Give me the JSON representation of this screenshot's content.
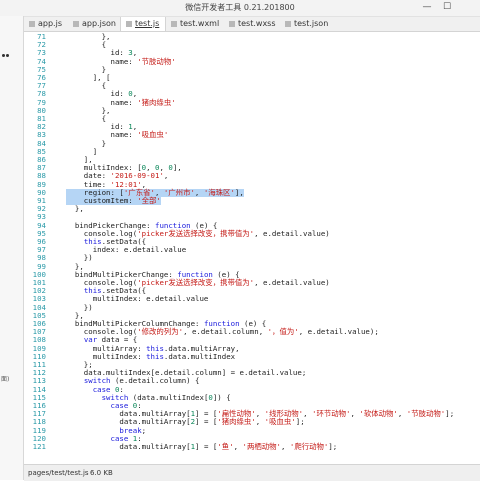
{
  "window": {
    "title": "微信开发者工具 0.21.201800",
    "minimize": "—",
    "maximize": "☐"
  },
  "sidebar": {
    "fragment_text": "面)"
  },
  "tabs": [
    {
      "label": "app.js",
      "active": false
    },
    {
      "label": "app.json",
      "active": false
    },
    {
      "label": "test.js",
      "active": true
    },
    {
      "label": "test.wxml",
      "active": false
    },
    {
      "label": "test.wxss",
      "active": false
    },
    {
      "label": "test.json",
      "active": false
    }
  ],
  "editor": {
    "lines": [
      {
        "num": "71",
        "tokens": [
          {
            "t": "        },",
            "c": "p"
          }
        ]
      },
      {
        "num": "72",
        "tokens": [
          {
            "t": "        {",
            "c": "p"
          }
        ]
      },
      {
        "num": "73",
        "tokens": [
          {
            "t": "          id: ",
            "c": "p"
          },
          {
            "t": "3",
            "c": "n"
          },
          {
            "t": ",",
            "c": "p"
          }
        ]
      },
      {
        "num": "74",
        "tokens": [
          {
            "t": "          name: ",
            "c": "p"
          },
          {
            "t": "'节肢动物'",
            "c": "s"
          }
        ]
      },
      {
        "num": "75",
        "tokens": [
          {
            "t": "        }",
            "c": "p"
          }
        ]
      },
      {
        "num": "76",
        "tokens": [
          {
            "t": "      ], [",
            "c": "p"
          }
        ]
      },
      {
        "num": "77",
        "tokens": [
          {
            "t": "        {",
            "c": "p"
          }
        ]
      },
      {
        "num": "78",
        "tokens": [
          {
            "t": "          id: ",
            "c": "p"
          },
          {
            "t": "0",
            "c": "n"
          },
          {
            "t": ",",
            "c": "p"
          }
        ]
      },
      {
        "num": "79",
        "tokens": [
          {
            "t": "          name: ",
            "c": "p"
          },
          {
            "t": "'猪肉绦虫'",
            "c": "s"
          }
        ]
      },
      {
        "num": "80",
        "tokens": [
          {
            "t": "        },",
            "c": "p"
          }
        ]
      },
      {
        "num": "81",
        "tokens": [
          {
            "t": "        {",
            "c": "p"
          }
        ]
      },
      {
        "num": "82",
        "tokens": [
          {
            "t": "          id: ",
            "c": "p"
          },
          {
            "t": "1",
            "c": "n"
          },
          {
            "t": ",",
            "c": "p"
          }
        ]
      },
      {
        "num": "83",
        "tokens": [
          {
            "t": "          name: ",
            "c": "p"
          },
          {
            "t": "'吸血虫'",
            "c": "s"
          }
        ]
      },
      {
        "num": "84",
        "tokens": [
          {
            "t": "        }",
            "c": "p"
          }
        ]
      },
      {
        "num": "85",
        "tokens": [
          {
            "t": "      ]",
            "c": "p"
          }
        ]
      },
      {
        "num": "86",
        "tokens": [
          {
            "t": "    ],",
            "c": "p"
          }
        ]
      },
      {
        "num": "87",
        "tokens": [
          {
            "t": "    multiIndex: [",
            "c": "p"
          },
          {
            "t": "0",
            "c": "n"
          },
          {
            "t": ", ",
            "c": "p"
          },
          {
            "t": "0",
            "c": "n"
          },
          {
            "t": ", ",
            "c": "p"
          },
          {
            "t": "0",
            "c": "n"
          },
          {
            "t": "],",
            "c": "p"
          }
        ]
      },
      {
        "num": "88",
        "tokens": [
          {
            "t": "    date: ",
            "c": "p"
          },
          {
            "t": "'2016-09-01'",
            "c": "s"
          },
          {
            "t": ",",
            "c": "p"
          }
        ]
      },
      {
        "num": "89",
        "tokens": [
          {
            "t": "    time: ",
            "c": "p"
          },
          {
            "t": "'12:01'",
            "c": "s"
          },
          {
            "t": ",",
            "c": "p"
          }
        ]
      },
      {
        "num": "90",
        "hl": true,
        "tokens": [
          {
            "t": "    region: [",
            "c": "p"
          },
          {
            "t": "'广东省'",
            "c": "s"
          },
          {
            "t": ", ",
            "c": "p"
          },
          {
            "t": "'广州市'",
            "c": "s"
          },
          {
            "t": ", ",
            "c": "p"
          },
          {
            "t": "'海珠区'",
            "c": "s"
          },
          {
            "t": "],",
            "c": "p"
          }
        ]
      },
      {
        "num": "91",
        "hl": true,
        "tokens": [
          {
            "t": "    customItem: ",
            "c": "p"
          },
          {
            "t": "'全部'",
            "c": "s"
          }
        ]
      },
      {
        "num": "92",
        "tokens": [
          {
            "t": "  },",
            "c": "p"
          }
        ]
      },
      {
        "num": "93",
        "tokens": [
          {
            "t": "",
            "c": "p"
          }
        ]
      },
      {
        "num": "94",
        "tokens": [
          {
            "t": "  bindPickerChange: ",
            "c": "p"
          },
          {
            "t": "function",
            "c": "k"
          },
          {
            "t": " (e) {",
            "c": "p"
          }
        ]
      },
      {
        "num": "95",
        "tokens": [
          {
            "t": "    console.log(",
            "c": "p"
          },
          {
            "t": "'picker发送选择改变，携带值为'",
            "c": "s"
          },
          {
            "t": ", e.detail.value)",
            "c": "p"
          }
        ]
      },
      {
        "num": "96",
        "tokens": [
          {
            "t": "    ",
            "c": "p"
          },
          {
            "t": "this",
            "c": "k"
          },
          {
            "t": ".setData({",
            "c": "p"
          }
        ]
      },
      {
        "num": "97",
        "tokens": [
          {
            "t": "      index: e.detail.value",
            "c": "p"
          }
        ]
      },
      {
        "num": "98",
        "tokens": [
          {
            "t": "    })",
            "c": "p"
          }
        ]
      },
      {
        "num": "99",
        "tokens": [
          {
            "t": "  },",
            "c": "p"
          }
        ]
      },
      {
        "num": "100",
        "tokens": [
          {
            "t": "  bindMultiPickerChange: ",
            "c": "p"
          },
          {
            "t": "function",
            "c": "k"
          },
          {
            "t": " (e) {",
            "c": "p"
          }
        ]
      },
      {
        "num": "101",
        "tokens": [
          {
            "t": "    console.log(",
            "c": "p"
          },
          {
            "t": "'picker发送选择改变，携带值为'",
            "c": "s"
          },
          {
            "t": ", e.detail.value)",
            "c": "p"
          }
        ]
      },
      {
        "num": "102",
        "tokens": [
          {
            "t": "    ",
            "c": "p"
          },
          {
            "t": "this",
            "c": "k"
          },
          {
            "t": ".setData({",
            "c": "p"
          }
        ]
      },
      {
        "num": "103",
        "tokens": [
          {
            "t": "      multiIndex: e.detail.value",
            "c": "p"
          }
        ]
      },
      {
        "num": "104",
        "tokens": [
          {
            "t": "    })",
            "c": "p"
          }
        ]
      },
      {
        "num": "105",
        "tokens": [
          {
            "t": "  },",
            "c": "p"
          }
        ]
      },
      {
        "num": "106",
        "tokens": [
          {
            "t": "  bindMultiPickerColumnChange: ",
            "c": "p"
          },
          {
            "t": "function",
            "c": "k"
          },
          {
            "t": " (e) {",
            "c": "p"
          }
        ]
      },
      {
        "num": "107",
        "tokens": [
          {
            "t": "    console.log(",
            "c": "p"
          },
          {
            "t": "'修改的列为'",
            "c": "s"
          },
          {
            "t": ", e.detail.column, ",
            "c": "p"
          },
          {
            "t": "'，值为'",
            "c": "s"
          },
          {
            "t": ", e.detail.value);",
            "c": "p"
          }
        ]
      },
      {
        "num": "108",
        "tokens": [
          {
            "t": "    ",
            "c": "p"
          },
          {
            "t": "var",
            "c": "k"
          },
          {
            "t": " data = {",
            "c": "p"
          }
        ]
      },
      {
        "num": "109",
        "tokens": [
          {
            "t": "      multiArray: ",
            "c": "p"
          },
          {
            "t": "this",
            "c": "k"
          },
          {
            "t": ".data.multiArray,",
            "c": "p"
          }
        ]
      },
      {
        "num": "110",
        "tokens": [
          {
            "t": "      multiIndex: ",
            "c": "p"
          },
          {
            "t": "this",
            "c": "k"
          },
          {
            "t": ".data.multiIndex",
            "c": "p"
          }
        ]
      },
      {
        "num": "111",
        "tokens": [
          {
            "t": "    };",
            "c": "p"
          }
        ]
      },
      {
        "num": "112",
        "tokens": [
          {
            "t": "    data.multiIndex[e.detail.column] = e.detail.value;",
            "c": "p"
          }
        ]
      },
      {
        "num": "113",
        "tokens": [
          {
            "t": "    ",
            "c": "p"
          },
          {
            "t": "switch",
            "c": "k"
          },
          {
            "t": " (e.detail.column) {",
            "c": "p"
          }
        ]
      },
      {
        "num": "114",
        "tokens": [
          {
            "t": "      ",
            "c": "p"
          },
          {
            "t": "case",
            "c": "k"
          },
          {
            "t": " ",
            "c": "p"
          },
          {
            "t": "0",
            "c": "n"
          },
          {
            "t": ":",
            "c": "p"
          }
        ]
      },
      {
        "num": "115",
        "tokens": [
          {
            "t": "        ",
            "c": "p"
          },
          {
            "t": "switch",
            "c": "k"
          },
          {
            "t": " (data.multiIndex[",
            "c": "p"
          },
          {
            "t": "0",
            "c": "n"
          },
          {
            "t": "]) {",
            "c": "p"
          }
        ]
      },
      {
        "num": "116",
        "tokens": [
          {
            "t": "          ",
            "c": "p"
          },
          {
            "t": "case",
            "c": "k"
          },
          {
            "t": " ",
            "c": "p"
          },
          {
            "t": "0",
            "c": "n"
          },
          {
            "t": ":",
            "c": "p"
          }
        ]
      },
      {
        "num": "117",
        "tokens": [
          {
            "t": "            data.multiArray[",
            "c": "p"
          },
          {
            "t": "1",
            "c": "n"
          },
          {
            "t": "] = [",
            "c": "p"
          },
          {
            "t": "'扁性动物'",
            "c": "s"
          },
          {
            "t": ", ",
            "c": "p"
          },
          {
            "t": "'线形动物'",
            "c": "s"
          },
          {
            "t": ", ",
            "c": "p"
          },
          {
            "t": "'环节动物'",
            "c": "s"
          },
          {
            "t": ", ",
            "c": "p"
          },
          {
            "t": "'软体动物'",
            "c": "s"
          },
          {
            "t": ", ",
            "c": "p"
          },
          {
            "t": "'节肢动物'",
            "c": "s"
          },
          {
            "t": "];",
            "c": "p"
          }
        ]
      },
      {
        "num": "118",
        "tokens": [
          {
            "t": "            data.multiArray[",
            "c": "p"
          },
          {
            "t": "2",
            "c": "n"
          },
          {
            "t": "] = [",
            "c": "p"
          },
          {
            "t": "'猪肉绦虫'",
            "c": "s"
          },
          {
            "t": ", ",
            "c": "p"
          },
          {
            "t": "'吸血虫'",
            "c": "s"
          },
          {
            "t": "];",
            "c": "p"
          }
        ]
      },
      {
        "num": "119",
        "tokens": [
          {
            "t": "            ",
            "c": "p"
          },
          {
            "t": "break",
            "c": "k"
          },
          {
            "t": ";",
            "c": "p"
          }
        ]
      },
      {
        "num": "120",
        "tokens": [
          {
            "t": "          ",
            "c": "p"
          },
          {
            "t": "case",
            "c": "k"
          },
          {
            "t": " ",
            "c": "p"
          },
          {
            "t": "1",
            "c": "n"
          },
          {
            "t": ":",
            "c": "p"
          }
        ]
      },
      {
        "num": "121",
        "tokens": [
          {
            "t": "            data.multiArray[",
            "c": "p"
          },
          {
            "t": "1",
            "c": "n"
          },
          {
            "t": "] = [",
            "c": "p"
          },
          {
            "t": "'鱼'",
            "c": "s"
          },
          {
            "t": ", ",
            "c": "p"
          },
          {
            "t": "'两栖动物'",
            "c": "s"
          },
          {
            "t": ", ",
            "c": "p"
          },
          {
            "t": "'爬行动物'",
            "c": "s"
          },
          {
            "t": "];",
            "c": "p"
          }
        ]
      }
    ]
  },
  "status": {
    "path": "pages/test/test.js",
    "size": "6.0 KB"
  }
}
